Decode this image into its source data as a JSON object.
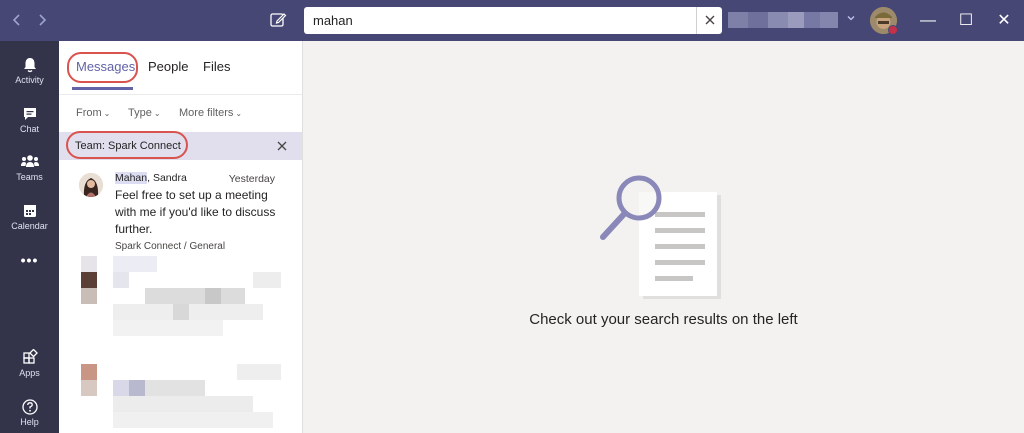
{
  "titlebar": {
    "back_icon": "chevron-left-icon",
    "forward_icon": "chevron-right-icon",
    "compose_icon": "compose-icon",
    "search": {
      "value": "mahan",
      "clear_icon": "close-icon"
    },
    "tenant_icon": "chevron-down-icon",
    "window": {
      "minimize": "—",
      "maximize": "☐",
      "close": "✕"
    }
  },
  "rail": {
    "items": [
      {
        "label": "Activity",
        "icon": "bell-icon"
      },
      {
        "label": "Chat",
        "icon": "chat-icon"
      },
      {
        "label": "Teams",
        "icon": "teams-icon"
      },
      {
        "label": "Calendar",
        "icon": "calendar-icon"
      },
      {
        "label": "•••",
        "icon": "more-icon"
      },
      {
        "label": "Apps",
        "icon": "apps-icon"
      },
      {
        "label": "Help",
        "icon": "help-icon"
      }
    ]
  },
  "panel": {
    "tabs": [
      {
        "label": "Messages"
      },
      {
        "label": "People"
      },
      {
        "label": "Files"
      }
    ],
    "filters": [
      {
        "label": "From"
      },
      {
        "label": "Type"
      },
      {
        "label": "More filters"
      }
    ],
    "team_filter": {
      "label": "Team: Spark Connect",
      "remove_icon": "close-icon"
    },
    "result": {
      "sender_highlight": "Mahan",
      "sender_rest": ", Sandra",
      "time": "Yesterday",
      "body": "Feel free to set up a meeting with me if you'd like to discuss further.",
      "channel": "Spark Connect / General"
    }
  },
  "main": {
    "empty_message": "Check out your search results on the left"
  },
  "colors": {
    "titlebar": "#464775",
    "rail": "#33344a",
    "accent": "#6264a7",
    "chip": "#e1dfee",
    "callout": "#d9534f"
  }
}
